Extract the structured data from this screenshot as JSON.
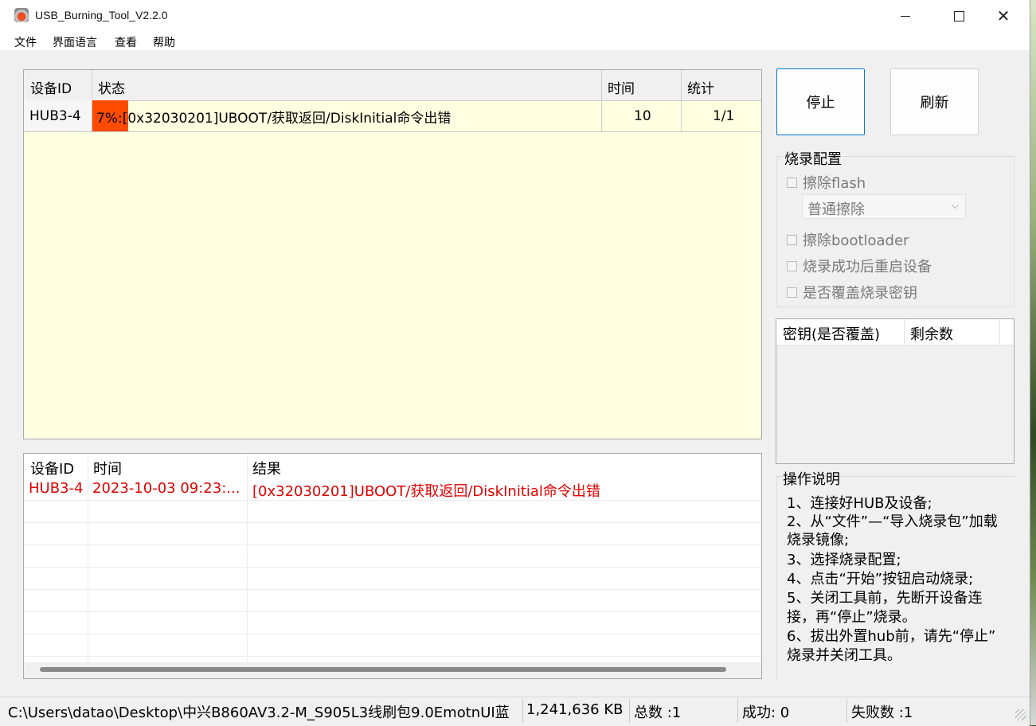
{
  "window": {
    "title": "USB_Burning_Tool_V2.2.0",
    "controls": {
      "minimize": "",
      "maximize": "",
      "close": "✕"
    }
  },
  "menu": [
    "文件",
    "界面语言",
    "查看",
    "帮助"
  ],
  "device_table": {
    "headers": [
      "设备ID",
      "状态",
      "时间",
      "统计"
    ],
    "rows": [
      {
        "device_id": "HUB3-4",
        "status": "7%:[0x32030201]UBOOT/获取返回/DiskInitial命令出错",
        "progress_percent": 7,
        "time": "10",
        "stat": "1/1"
      }
    ]
  },
  "buttons": {
    "stop": "停止",
    "refresh": "刷新"
  },
  "burn_config": {
    "title": "烧录配置",
    "erase_flash": "擦除flash",
    "erase_mode": "普通擦除",
    "erase_bootloader": "擦除bootloader",
    "reboot_after_success": "烧录成功后重启设备",
    "overwrite_key": "是否覆盖烧录密钥"
  },
  "key_list": {
    "headers": [
      "密钥(是否覆盖)",
      "剩余数"
    ]
  },
  "instructions": {
    "title": "操作说明",
    "lines": [
      "1、连接好HUB及设备;",
      "2、从“文件”—“导入烧录包”加载",
      "烧录镜像;",
      "3、选择烧录配置;",
      "4、点击“开始”按钮启动烧录;",
      "5、关闭工具前，先断开设备连",
      "接，再“停止”烧录。",
      "6、拔出外置hub前，请先“停止”",
      "烧录并关闭工具。"
    ]
  },
  "log_table": {
    "headers": [
      "设备ID",
      "时间",
      "结果"
    ],
    "rows": [
      {
        "device_id": "HUB3-4",
        "time": "2023-10-03 09:23:...",
        "result": "[0x32030201]UBOOT/获取返回/DiskInitial命令出错"
      }
    ],
    "text_color": "#e00000"
  },
  "status_bar": {
    "path": "C:\\Users\\datao\\Desktop\\中兴B860AV3.2-M_S905L3线刷包9.0EmotnUI蓝",
    "size": "1,241,636 KB",
    "total": "总数 :1",
    "success": "成功:  0",
    "failed": "失败数 :1"
  },
  "colors": {
    "progress": "#ff4b00",
    "table_bg": "#ffffe1",
    "error_text": "#e00000",
    "focus_border": "#0078d7"
  }
}
